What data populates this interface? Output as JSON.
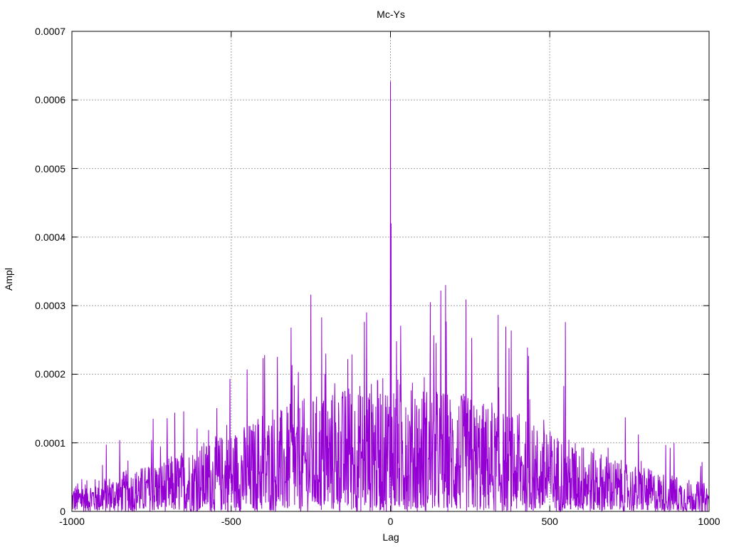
{
  "chart_data": {
    "type": "line",
    "title": "Mc-Ys",
    "xlabel": "Lag",
    "ylabel": "Ampl",
    "xlim": [
      -1000,
      1000
    ],
    "ylim": [
      0,
      0.0007
    ],
    "x_ticks": [
      "-1000",
      "-500",
      "0",
      "500",
      "1000"
    ],
    "y_ticks": [
      "0",
      "0.0001",
      "0.0002",
      "0.0003",
      "0.0004",
      "0.0005",
      "0.0006",
      "0.0007"
    ],
    "grid": true,
    "line_color": "#9400d3",
    "notable_peaks": [
      {
        "x": 0,
        "y": 0.000627
      },
      {
        "x": 2,
        "y": 0.00042
      },
      {
        "x": 158,
        "y": 0.000322
      },
      {
        "x": 125,
        "y": 0.000305
      },
      {
        "x": 237,
        "y": 0.000309
      },
      {
        "x": -75,
        "y": 0.00029
      },
      {
        "x": -312,
        "y": 0.000268
      },
      {
        "x": 549,
        "y": 0.000276
      },
      {
        "x": 372,
        "y": 0.000238
      },
      {
        "x": -395,
        "y": 0.000228
      },
      {
        "x": -504,
        "y": 0.000193
      },
      {
        "x": -745,
        "y": 0.000135
      },
      {
        "x": -850,
        "y": 0.000104
      },
      {
        "x": 778,
        "y": 0.000112
      },
      {
        "x": 890,
        "y": 0.0001
      }
    ],
    "envelope": [
      {
        "x": -1000,
        "y": 4e-05
      },
      {
        "x": -750,
        "y": 7e-05
      },
      {
        "x": -500,
        "y": 0.00012
      },
      {
        "x": -250,
        "y": 0.00017
      },
      {
        "x": 0,
        "y": 0.0002
      },
      {
        "x": 250,
        "y": 0.00017
      },
      {
        "x": 500,
        "y": 0.00012
      },
      {
        "x": 750,
        "y": 7e-05
      },
      {
        "x": 1000,
        "y": 4e-05
      }
    ]
  }
}
